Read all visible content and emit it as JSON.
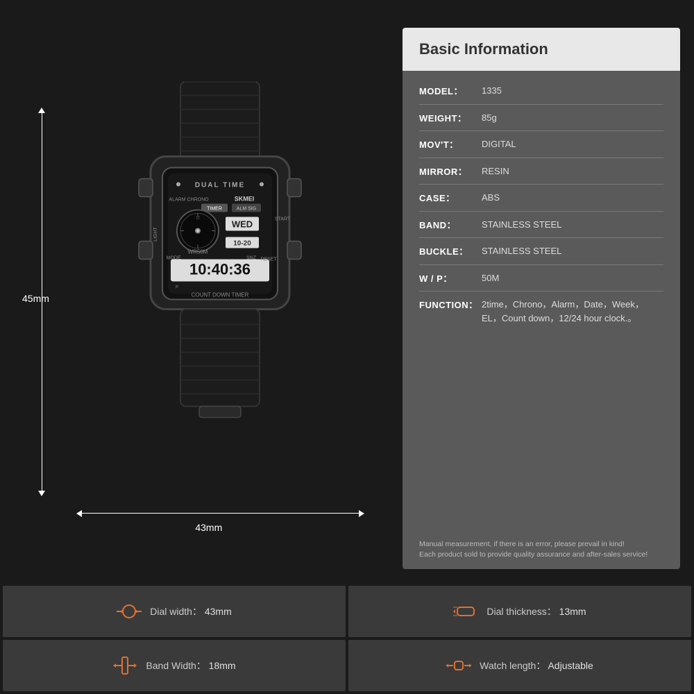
{
  "page": {
    "background_color": "#1a1a1a"
  },
  "info_panel": {
    "title": "Basic Information",
    "rows": [
      {
        "label": "MODEL：",
        "value": "1335"
      },
      {
        "label": "WEIGHT：",
        "value": "85g"
      },
      {
        "label": "MOV'T：",
        "value": "DIGITAL"
      },
      {
        "label": "MIRROR：",
        "value": "RESIN"
      },
      {
        "label": "CASE：",
        "value": "ABS"
      },
      {
        "label": "BAND：",
        "value": "STAINLESS STEEL"
      },
      {
        "label": "BUCKLE：",
        "value": "STAINLESS STEEL"
      },
      {
        "label": "W / P：",
        "value": "50M"
      },
      {
        "label": "FUNCTION：",
        "value": "2time，Chrono，Alarm，Date，Week，EL，Count down，12/24 hour clock.。"
      }
    ],
    "note_line1": "Manual measurement, if there is an error, please prevail in kind!",
    "note_line2": "Each product sold to provide quality assurance and after-sales service!"
  },
  "dimensions": {
    "height": "45mm",
    "width": "43mm"
  },
  "specs": [
    {
      "icon": "⊙",
      "key": "Dial width：",
      "value": "43mm",
      "icon_name": "dial-width-icon"
    },
    {
      "icon": "⌂",
      "key": "Dial thickness：",
      "value": "13mm",
      "icon_name": "dial-thickness-icon"
    },
    {
      "icon": "▮",
      "key": "Band Width：",
      "value": "18mm",
      "icon_name": "band-width-icon"
    },
    {
      "icon": "⊗",
      "key": "Watch length：",
      "value": "Adjustable",
      "icon_name": "watch-length-icon"
    }
  ]
}
